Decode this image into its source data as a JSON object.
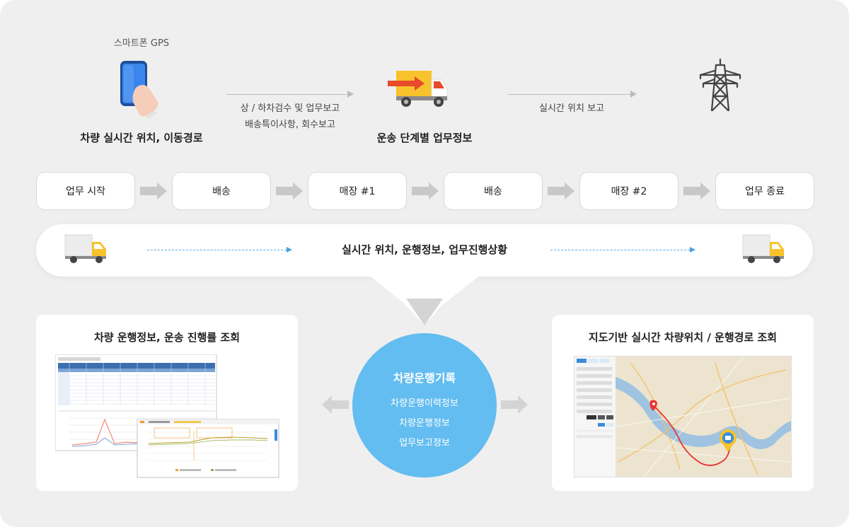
{
  "top": {
    "gps_label": "스마트폰 GPS",
    "phone_caption": "차량 실시간 위치, 이동경로",
    "arrow1_line1": "상 / 하차검수 및 업무보고",
    "arrow1_line2": "배송특이사항, 회수보고",
    "truck_caption": "운송 단계별 업무정보",
    "arrow2_caption": "실시간 위치 보고"
  },
  "steps": [
    {
      "label": "업무 시작"
    },
    {
      "label": "배송"
    },
    {
      "label": "매장 #1"
    },
    {
      "label": "배송"
    },
    {
      "label": "매장 #2"
    },
    {
      "label": "업무 종료"
    }
  ],
  "status_bar": {
    "text": "실시간 위치, 운행정보, 업무진행상황"
  },
  "left_card": {
    "title": "차량 운행정보, 운송 진행률 조회"
  },
  "center_circle": {
    "title": "차량운행기록",
    "items": [
      "차량운행이력정보",
      "차량운행정보",
      "업무보고정보"
    ]
  },
  "right_card": {
    "title": "지도기반 실시간 차량위치 / 운행경로 조회"
  },
  "colors": {
    "background": "#efefef",
    "circle": "#63bdf0",
    "accent_blue": "#4aa0e2",
    "truck_red": "#e84a2a",
    "truck_yellow": "#f7c22b"
  }
}
